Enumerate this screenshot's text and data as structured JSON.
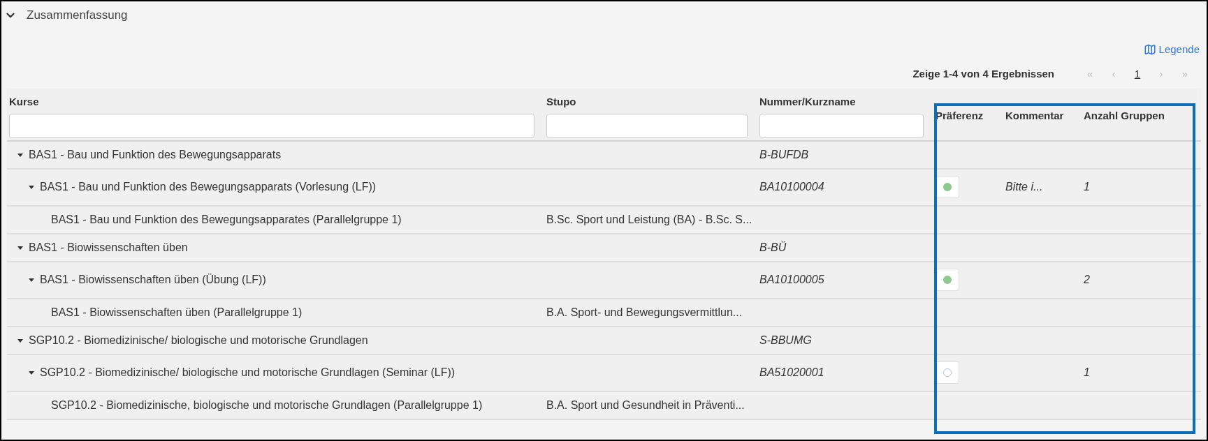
{
  "section": {
    "title": "Zusammenfassung",
    "expanded": true
  },
  "legend_link": "Legende",
  "results_summary": "Zeige 1-4 von 4 Ergebnissen",
  "pagination": [
    {
      "label": "«",
      "kind": "nav",
      "disabled": true
    },
    {
      "label": "‹",
      "kind": "nav",
      "disabled": true
    },
    {
      "label": "1",
      "kind": "page",
      "selected": true
    },
    {
      "label": "›",
      "kind": "nav",
      "disabled": true
    },
    {
      "label": "»",
      "kind": "nav",
      "disabled": true
    }
  ],
  "columns": [
    {
      "label": "Kurse",
      "filter": true
    },
    {
      "label": "Stupo",
      "filter": true
    },
    {
      "label": "Nummer/Kurzname",
      "filter": true
    },
    {
      "label": "Präferenz",
      "filter": false
    },
    {
      "label": "Kommentar",
      "filter": false
    },
    {
      "label": "Anzahl Gruppen",
      "filter": false
    }
  ],
  "rows": [
    {
      "name": "BAS1 - Bau und Funktion des Bewegungsapparats",
      "expanded": true,
      "nummer": "B-BUFDB",
      "children": [
        {
          "name": "BAS1 - Bau und Funktion des Bewegungsapparats (Vorlesung (LF))",
          "expanded": true,
          "nummer": "BA10100004",
          "preference": {
            "checked": true
          },
          "kommentar": "Bitte i...",
          "anzahl": "1",
          "children": [
            {
              "name": "BAS1 - Bau und Funktion des Bewegungsapparates (Parallelgruppe 1)",
              "stupo": "B.Sc. Sport und Leistung (BA) - B.Sc. S..."
            }
          ]
        }
      ]
    },
    {
      "name": "BAS1 - Biowissenschaften üben",
      "expanded": true,
      "nummer": "B-BÜ",
      "children": [
        {
          "name": "BAS1 - Biowissenschaften üben (Übung (LF))",
          "expanded": true,
          "nummer": "BA10100005",
          "preference": {
            "checked": true
          },
          "anzahl": "2",
          "children": [
            {
              "name": "BAS1 - Biowissenschaften üben (Parallelgruppe 1)",
              "stupo": "B.A. Sport- und Bewegungsvermittlun..."
            }
          ]
        }
      ]
    },
    {
      "name": "SGP10.2 - Biomedizinische/ biologische und motorische Grundlagen",
      "expanded": true,
      "nummer": "S-BBUMG",
      "children": [
        {
          "name": "SGP10.2 - Biomedizinische/ biologische und motorische Grundlagen (Seminar (LF))",
          "expanded": true,
          "nummer": "BA51020001",
          "preference": {
            "checked": false
          },
          "anzahl": "1",
          "children": [
            {
              "name": "SGP10.2 - Biomedizinische, biologische und motorische Grundlagen (Parallelgruppe 1)",
              "stupo": "B.A. Sport und Gesundheit in Präventi..."
            }
          ]
        }
      ]
    }
  ]
}
